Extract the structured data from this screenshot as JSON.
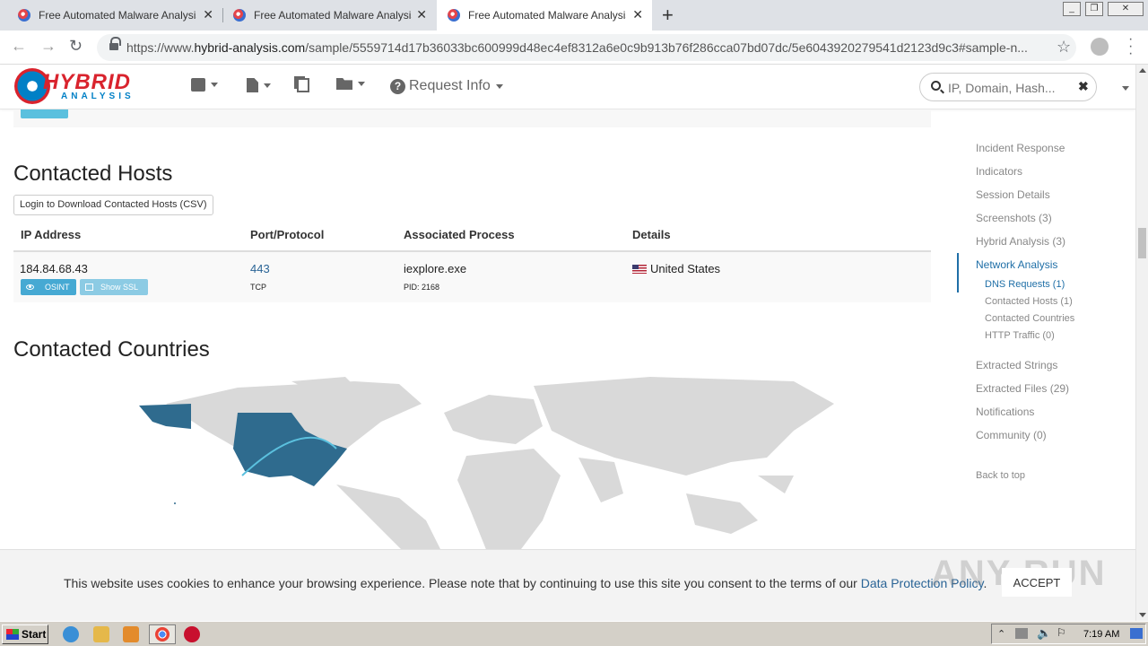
{
  "browser": {
    "tabs": [
      {
        "title": "Free Automated Malware Analysis Se",
        "active": false
      },
      {
        "title": "Free Automated Malware Analysis Se",
        "active": false
      },
      {
        "title": "Free Automated Malware Analysis Se",
        "active": true
      }
    ],
    "url_scheme": "https://www.",
    "url_host": "hybrid-analysis.com",
    "url_path": "/sample/5559714d17b36033bc600999d48ec4ef8312a6e0c9b913b76f286cca07bd07dc/5e6043920279541d2123d9c3#sample-n..."
  },
  "header": {
    "logo_top": "HYBRID",
    "logo_bottom": "ANALYSIS",
    "request_info": "Request Info",
    "search_placeholder": "IP, Domain, Hash..."
  },
  "contacted_hosts": {
    "title": "Contacted Hosts",
    "csv_button": "Login to Download Contacted Hosts (CSV)",
    "columns": [
      "IP Address",
      "Port/Protocol",
      "Associated Process",
      "Details"
    ],
    "rows": [
      {
        "ip": "184.84.68.43",
        "port": "443",
        "protocol": "TCP",
        "process": "iexplore.exe",
        "pid": "PID: 2168",
        "country": "United States",
        "osint_label": "OSINT",
        "ssl_label": "Show SSL"
      }
    ]
  },
  "contacted_countries": {
    "title": "Contacted Countries",
    "highlighted": [
      "United States"
    ],
    "colors": {
      "land": "#d9d9d9",
      "highlight": "#2f6b8e",
      "arc": "#5bc0de"
    }
  },
  "sidenav": {
    "items": [
      "Incident Response",
      "Indicators",
      "Session Details",
      "Screenshots (3)",
      "Hybrid Analysis (3)",
      "Network Analysis",
      "Extracted Strings",
      "Extracted Files (29)",
      "Notifications",
      "Community (0)"
    ],
    "active": "Network Analysis",
    "subitems": [
      "DNS Requests (1)",
      "Contacted Hosts (1)",
      "Contacted Countries",
      "HTTP Traffic (0)"
    ],
    "back_to_top": "Back to top"
  },
  "cookie": {
    "message": "This website uses cookies to enhance your browsing experience. Please note that by continuing to use this site you consent to the terms of our ",
    "link": "Data Protection Policy",
    "end": ".",
    "accept": "ACCEPT"
  },
  "watermark": "ANY RUN",
  "taskbar": {
    "start": "Start",
    "clock": "7:19 AM"
  }
}
